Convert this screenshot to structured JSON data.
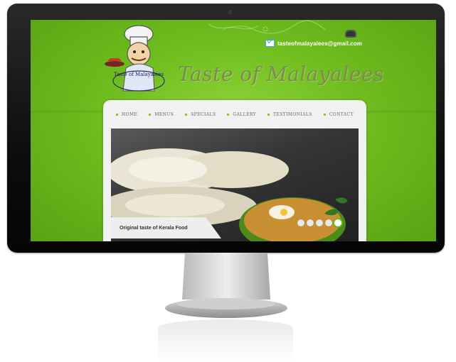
{
  "site": {
    "title": "Taste of Malayalees",
    "logo_text": "Taste of Malayalees",
    "contact": {
      "phone": "",
      "email": "tasteofmalayalees@gmail.com"
    }
  },
  "nav": {
    "items": [
      "HOME",
      "MENUS",
      "SPECIALS",
      "GALLERY",
      "TESTIMONIALS",
      "CONTACT"
    ]
  },
  "slider": {
    "caption": "Original taste of Kerala Food",
    "dots": 5,
    "active_dot": 5
  },
  "colors": {
    "accent": "#6bb31b",
    "background": "#6fbd1f",
    "brand_text": "#7f8a53"
  }
}
